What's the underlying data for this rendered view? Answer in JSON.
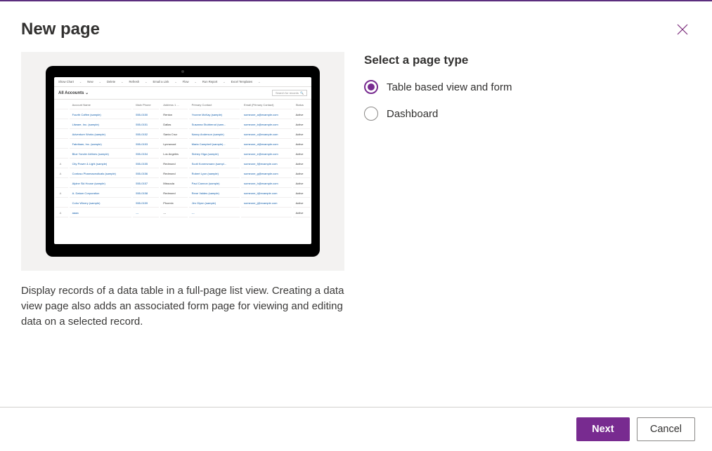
{
  "dialog": {
    "title": "New page",
    "description": "Display records of a data table in a full-page list view. Creating a data view page also adds an associated form page for viewing and editing data on a selected record."
  },
  "right_panel": {
    "heading": "Select a page type",
    "options": [
      {
        "label": "Table based view and form",
        "selected": true
      },
      {
        "label": "Dashboard",
        "selected": false
      }
    ]
  },
  "footer": {
    "primary": "Next",
    "secondary": "Cancel"
  },
  "preview": {
    "toolbar": [
      "Show Chart",
      "New",
      "Delete",
      "Refresh",
      "Email a Link",
      "Flow",
      "Run Report",
      "Excel Templates"
    ],
    "view_name": "All Accounts",
    "search_placeholder": "Search for records",
    "columns": [
      "",
      "Account Name",
      "Main Phone",
      "Address 1 ...",
      "Primary Contact",
      "Email (Primary Contact)",
      "Status"
    ],
    "rows": [
      {
        "icon": "",
        "name": "Fourth Coffee (sample)",
        "phone": "555-0150",
        "addr": "Renton",
        "contact": "Yvonne McKay (sample)",
        "email": "someone_a@example.com",
        "status": "Active"
      },
      {
        "icon": "",
        "name": "Litware, Inc. (sample)",
        "phone": "555-0151",
        "addr": "Dallas",
        "contact": "Susanna Stubberod (sam...",
        "email": "someone_b@example.com",
        "status": "Active"
      },
      {
        "icon": "",
        "name": "Adventure Works (sample)",
        "phone": "555-0152",
        "addr": "Santa Cruz",
        "contact": "Nancy Anderson (sample)",
        "email": "someone_c@example.com",
        "status": "Active"
      },
      {
        "icon": "",
        "name": "Fabrikam, Inc. (sample)",
        "phone": "555-0153",
        "addr": "Lynnwood",
        "contact": "Maria Campbell (sample)...",
        "email": "someone_d@example.com",
        "status": "Active"
      },
      {
        "icon": "",
        "name": "Blue Yonder Airlines (sample)",
        "phone": "555-0154",
        "addr": "Los Angeles",
        "contact": "Sidney Higa (sample)",
        "email": "someone_e@example.com",
        "status": "Active"
      },
      {
        "icon": "A",
        "name": "City Power & Light (sample)",
        "phone": "555-0155",
        "addr": "Redmond",
        "contact": "Scott Konersmann (sampl...",
        "email": "someone_f@example.com",
        "status": "Active"
      },
      {
        "icon": "A",
        "name": "Contoso Pharmaceuticals (sample)",
        "phone": "555-0156",
        "addr": "Redmond",
        "contact": "Robert Lyon (sample)",
        "email": "someone_g@example.com",
        "status": "Active"
      },
      {
        "icon": "",
        "name": "Alpine Ski House (sample)",
        "phone": "555-0157",
        "addr": "Missoula",
        "contact": "Paul Cannon (sample)",
        "email": "someone_h@example.com",
        "status": "Active"
      },
      {
        "icon": "A",
        "name": "A. Datum Corporation",
        "phone": "555-0158",
        "addr": "Redmond",
        "contact": "Rene Valdes (sample)",
        "email": "someone_i@example.com",
        "status": "Active"
      },
      {
        "icon": "",
        "name": "Coho Winery (sample)",
        "phone": "555-0159",
        "addr": "Phoenix",
        "contact": "Jim Glynn (sample)",
        "email": "someone_j@example.com",
        "status": "Active"
      },
      {
        "icon": "A",
        "name": "aaaa",
        "phone": "---",
        "addr": "---",
        "contact": "---",
        "email": "",
        "status": "Active"
      }
    ]
  }
}
